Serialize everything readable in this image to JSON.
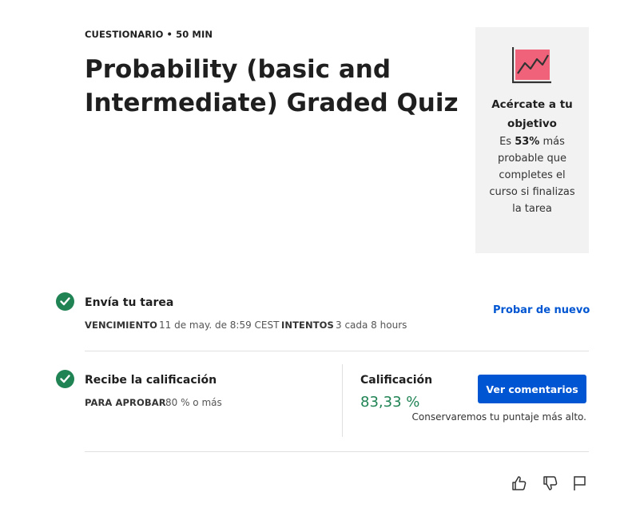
{
  "header": {
    "kicker": "CUESTIONARIO • 50 MIN",
    "title": "Probability (basic and Intermediate) Graded Quiz"
  },
  "goal_card": {
    "icon": "trend-chart-icon",
    "heading": "Acércate a tu objetivo",
    "text_prefix": "Es ",
    "percent": "53%",
    "text_suffix": " más probable que completes el curso si finalizas la tarea"
  },
  "submit_section": {
    "title": "Envía tu tarea",
    "due_label": "VENCIMIENTO",
    "due_value": "11 de may. de 8:59 CEST",
    "attempts_label": "INTENTOS",
    "attempts_value": "3 cada 8 hours",
    "retry_label": "Probar de nuevo"
  },
  "grade_section": {
    "title": "Recibe la calificación",
    "pass_label": "PARA APROBAR",
    "pass_value": "80 % o más",
    "grade_label": "Calificación",
    "grade_value": "83,33 %",
    "feedback_button": "Ver comentarios",
    "keep_note": "Conservaremos tu puntaje más alto."
  },
  "feedback_icons": [
    "thumbs-up-icon",
    "thumbs-down-icon",
    "flag-icon"
  ],
  "colors": {
    "accent": "#0056d2",
    "success": "#1f8354",
    "card_bg": "#f2f2f2",
    "chart_icon_fill": "#f0627a"
  }
}
